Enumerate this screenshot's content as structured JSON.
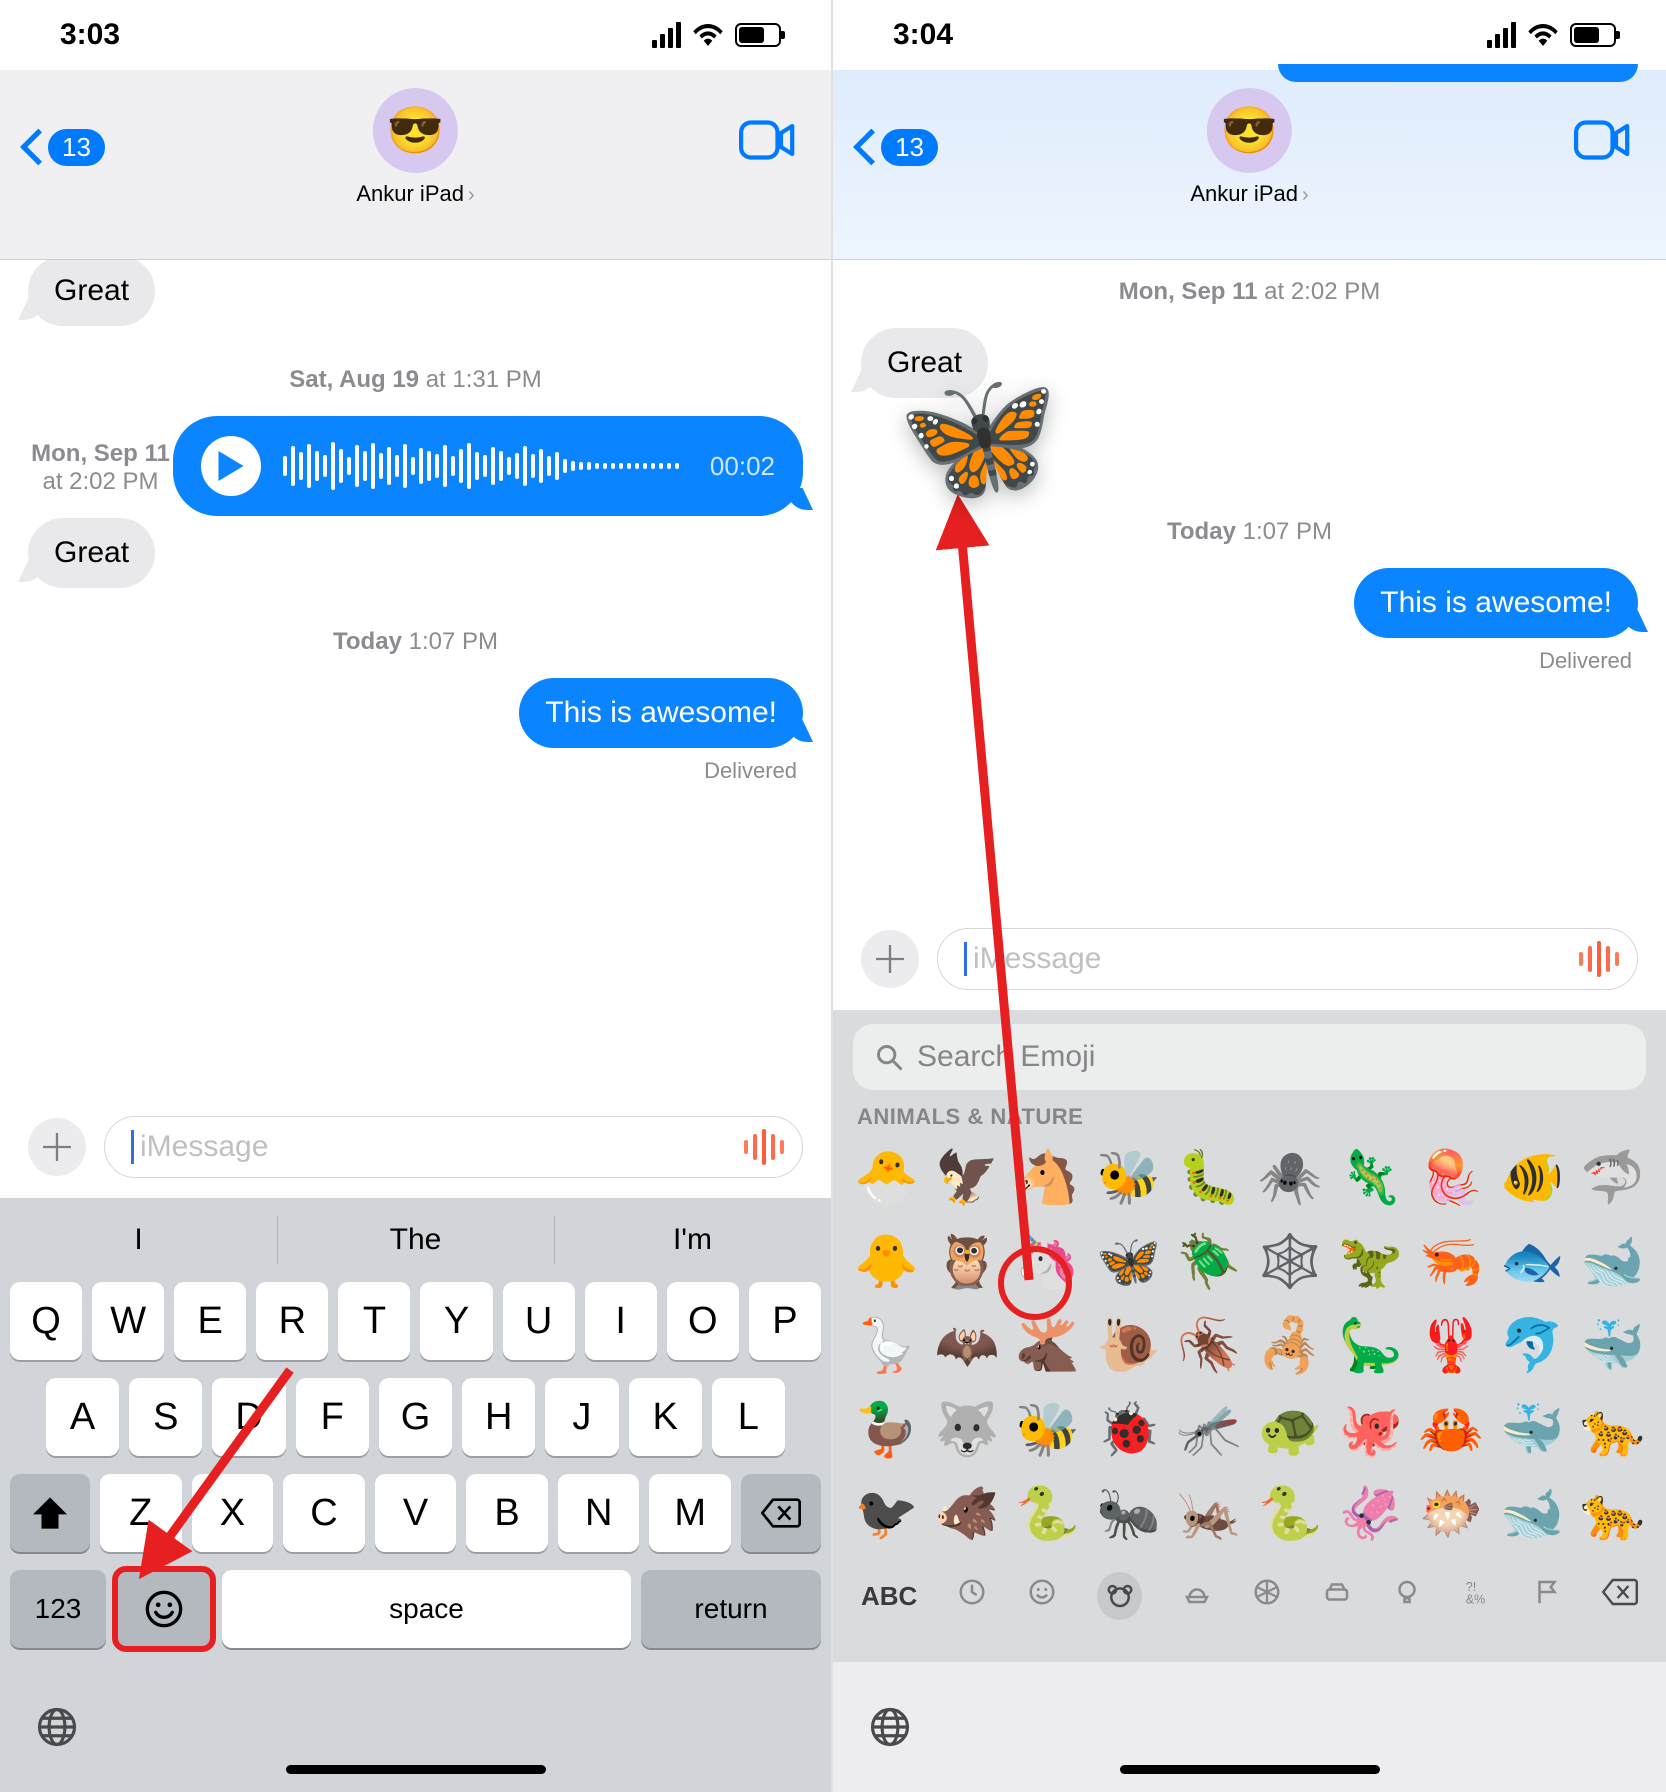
{
  "left": {
    "time": "3:03",
    "back_count": "13",
    "contact_name": "Ankur iPad",
    "avatar_emoji": "😎",
    "bubble_great": "Great",
    "ts_aug19": {
      "day": "Sat, Aug 19",
      "at": " at 1:31 PM"
    },
    "audio_duration": "00:02",
    "ts_sep11": {
      "day": "Mon, Sep 11",
      "at": " at 2:02 PM"
    },
    "bubble_great_2": "Great",
    "ts_today": {
      "day": "Today",
      "at": " 1:07 PM"
    },
    "outgoing": "This is awesome!",
    "delivered_label": "Delivered",
    "input_placeholder": "iMessage",
    "predict": [
      "I",
      "The",
      "I'm"
    ],
    "keys_r1": [
      "Q",
      "W",
      "E",
      "R",
      "T",
      "Y",
      "U",
      "I",
      "O",
      "P"
    ],
    "keys_r2": [
      "A",
      "S",
      "D",
      "F",
      "G",
      "H",
      "J",
      "K",
      "L"
    ],
    "keys_r3": [
      "Z",
      "X",
      "C",
      "V",
      "B",
      "N",
      "M"
    ],
    "fn_123": "123",
    "fn_space": "space",
    "fn_return": "return"
  },
  "right": {
    "time": "3:04",
    "back_count": "13",
    "contact_name": "Ankur iPad",
    "avatar_emoji": "😎",
    "ts_sep11": {
      "day": "Mon, Sep 11",
      "at": " at 2:02 PM"
    },
    "bubble_great": "Great",
    "ts_today": {
      "day": "Today",
      "at": " 1:07 PM"
    },
    "outgoing": "This is awesome!",
    "delivered_label": "Delivered",
    "input_placeholder": "iMessage",
    "search_placeholder": "Search Emoji",
    "category_label": "ANIMALS & NATURE",
    "butterfly_emoji": "🦋",
    "emoji_rows": [
      [
        "🐣",
        "🦅",
        "🐴",
        "🐝",
        "🐛",
        "🕷️",
        "🦎",
        "🪼",
        "🐠",
        "🦈"
      ],
      [
        "🐥",
        "🦉",
        "🦄",
        "🦋",
        "🪲",
        "🕸️",
        "🦖",
        "🦐",
        "🐟",
        "🐋"
      ],
      [
        "🪿",
        "🦇",
        "🫎",
        "🐌",
        "🪳",
        "🦂",
        "🦕",
        "🦞",
        "🐬",
        "🐳"
      ],
      [
        "🦆",
        "🐺",
        "🐝",
        "🐞",
        "🦟",
        "🐢",
        "🐙",
        "🦀",
        "🐳",
        "🐆"
      ],
      [
        "🐦‍⬛",
        "🐗",
        "🐍",
        "🐜",
        "🦗",
        "🐍",
        "🦑",
        "🐡",
        "🐋",
        "🐆"
      ]
    ],
    "abc_label": "ABC"
  }
}
